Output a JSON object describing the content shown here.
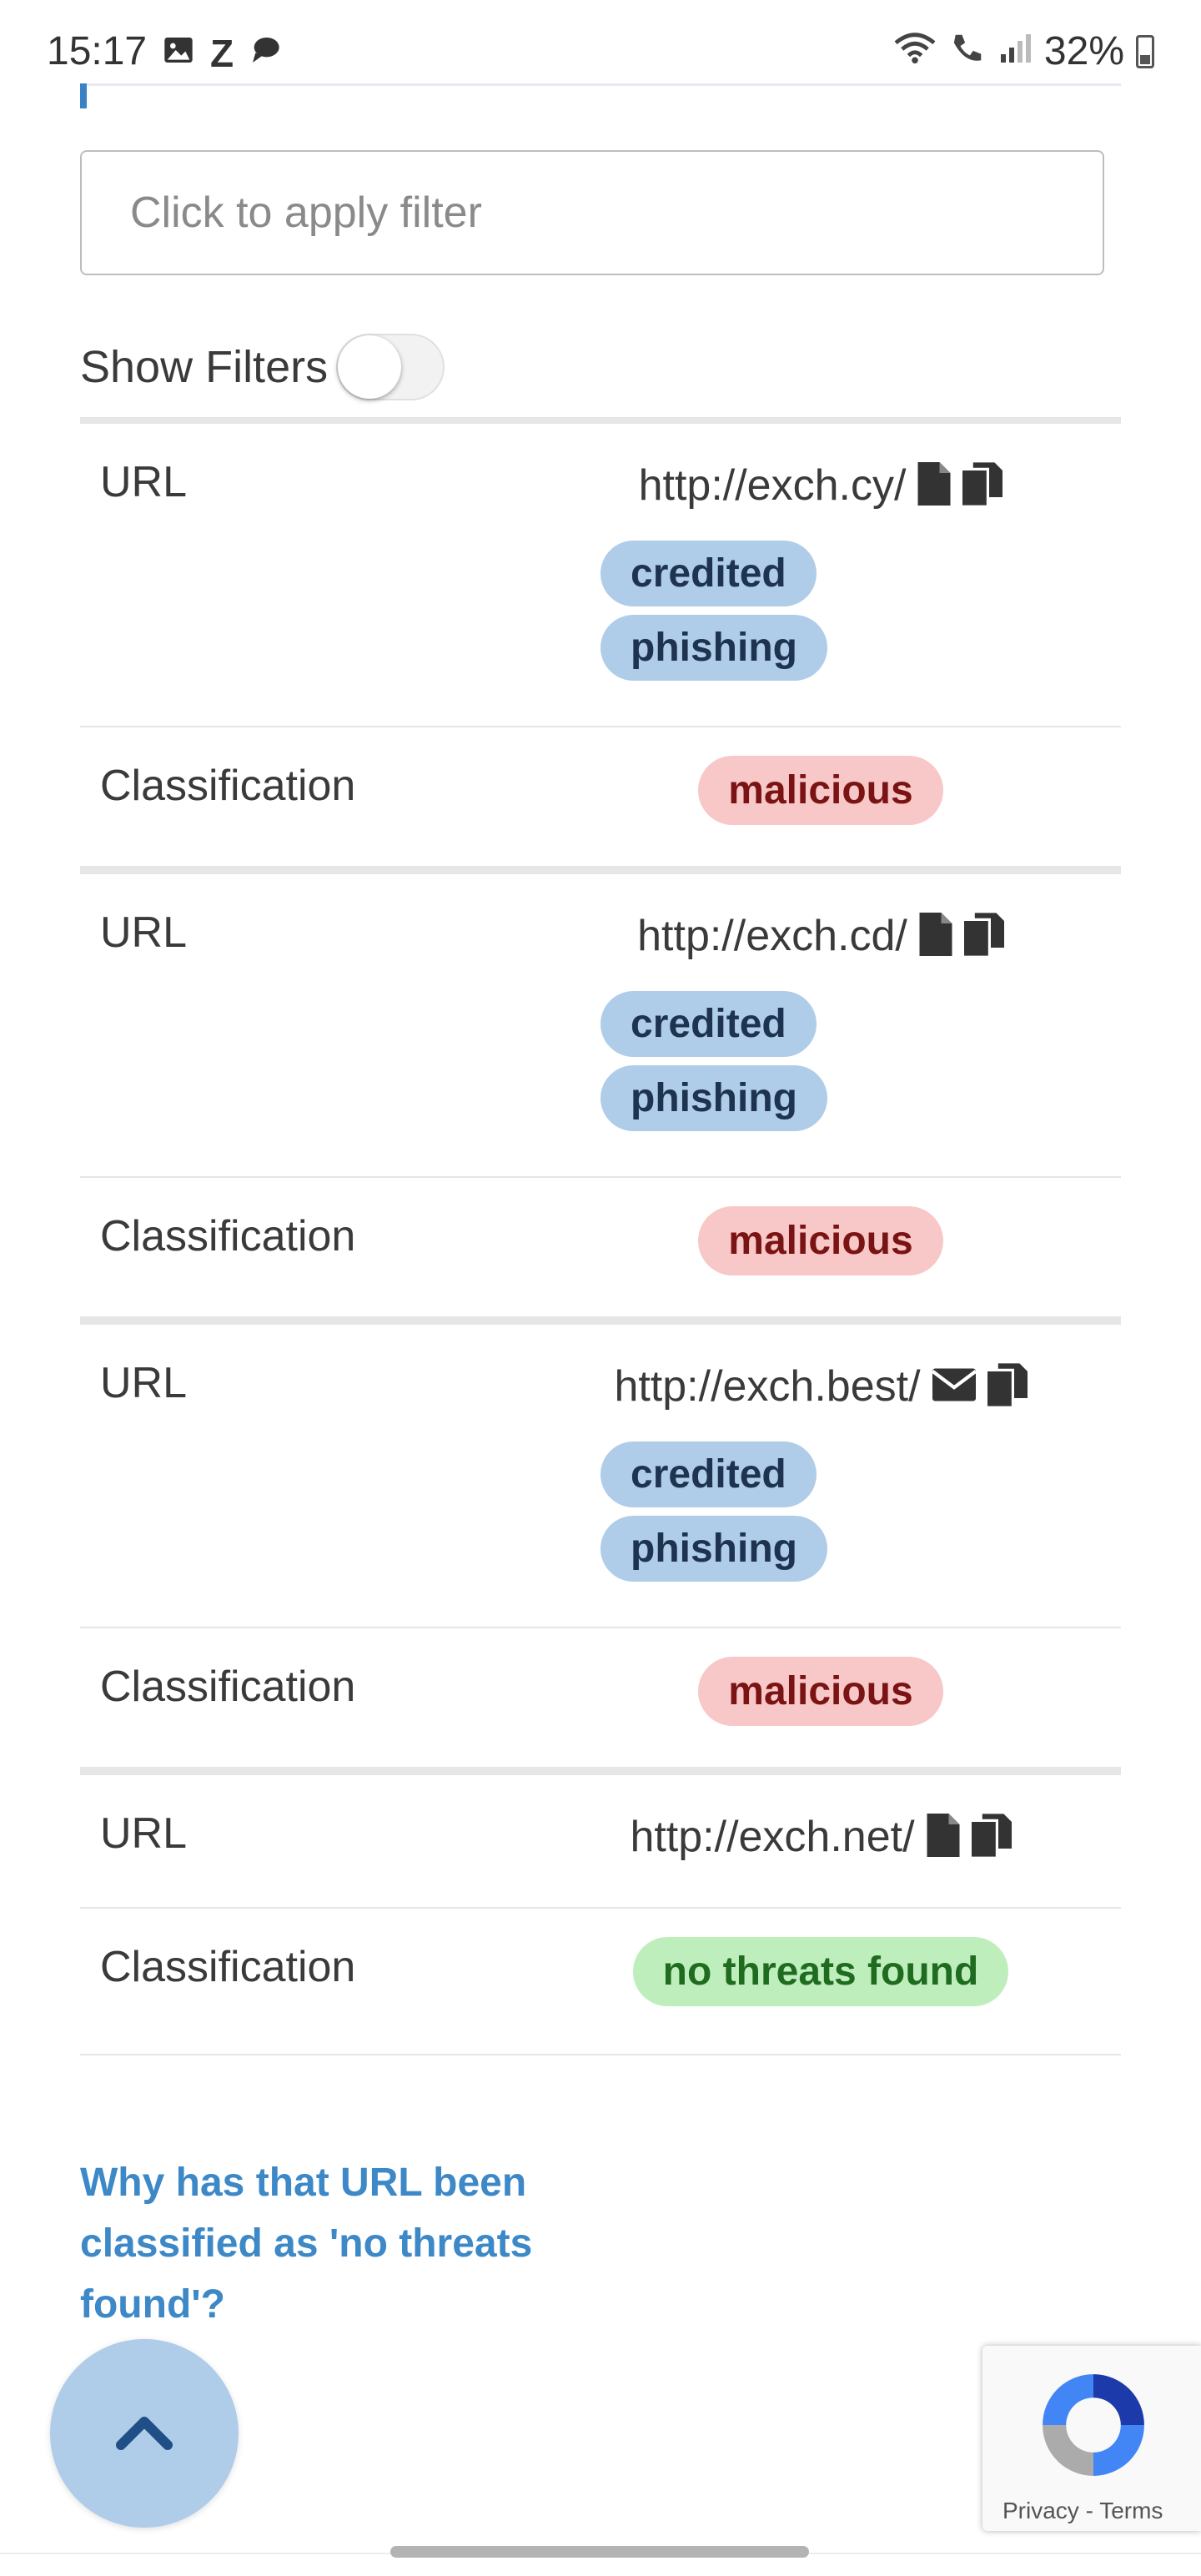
{
  "status_bar": {
    "time": "15:17",
    "left_icons": [
      "image-icon",
      "z-icon",
      "chat-icon"
    ],
    "right_icons": [
      "wifi-icon",
      "wifi-calling-icon",
      "signal-icon"
    ],
    "battery": "32%"
  },
  "filter": {
    "placeholder": "Click to apply filter",
    "value": ""
  },
  "show_filters": {
    "label": "Show Filters",
    "enabled": false
  },
  "results": [
    {
      "url_label": "URL",
      "url": "http://exch.cy/",
      "url_icons": [
        "file-icon",
        "copy-icon"
      ],
      "tags": [
        "credited",
        "phishing"
      ],
      "classification_label": "Classification",
      "classification": "malicious",
      "status": "malicious"
    },
    {
      "url_label": "URL",
      "url": "http://exch.cd/",
      "url_icons": [
        "file-icon",
        "copy-icon"
      ],
      "tags": [
        "credited",
        "phishing"
      ],
      "classification_label": "Classification",
      "classification": "malicious",
      "status": "malicious"
    },
    {
      "url_label": "URL",
      "url": "http://exch.best/",
      "url_icons": [
        "envelope-icon",
        "copy-icon"
      ],
      "tags": [
        "credited",
        "phishing"
      ],
      "classification_label": "Classification",
      "classification": "malicious",
      "status": "malicious"
    },
    {
      "url_label": "URL",
      "url": "http://exch.net/",
      "url_icons": [
        "file-icon",
        "copy-icon"
      ],
      "tags": [],
      "classification_label": "Classification",
      "classification": "no threats found",
      "status": "safe"
    }
  ],
  "why_link": "Why has that URL been classified as 'no threats found'?",
  "recaptcha": {
    "privacy": "Privacy",
    "separator": "-",
    "terms": "Terms"
  },
  "colors": {
    "tag_bg": "#afcde8",
    "tag_text": "#1e3350",
    "malicious_bg": "#f8c7c7",
    "malicious_text": "#7a1414",
    "safe_bg": "#bfeebd",
    "safe_text": "#1f6b1f",
    "link": "#3d88c7"
  }
}
